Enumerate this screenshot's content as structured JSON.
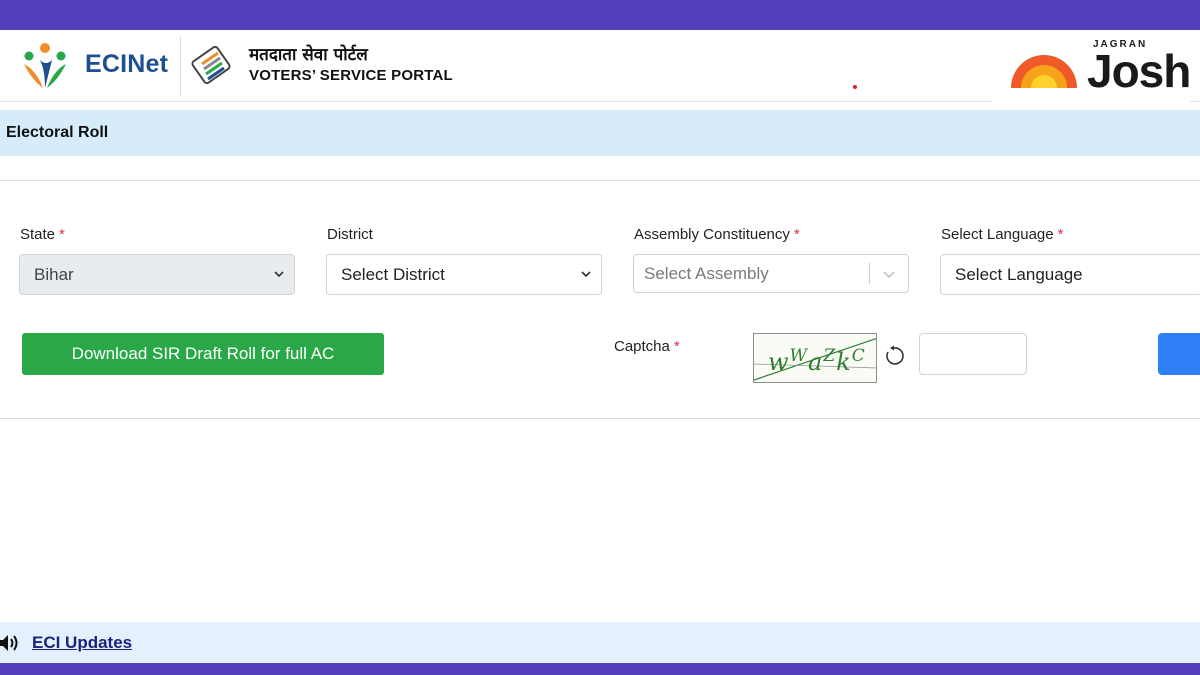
{
  "header": {
    "brand_name": "ECINet",
    "portal_title_hindi": "मतदाता सेवा पोर्टल",
    "portal_title_english": "VOTERS’ SERVICE PORTAL",
    "watermark": {
      "small": "JAGRAN",
      "big": "Josh"
    }
  },
  "section": {
    "title": "Electoral Roll"
  },
  "form": {
    "state": {
      "label": "State",
      "required_mark": "*",
      "value": "Bihar",
      "disabled": true
    },
    "district": {
      "label": "District",
      "placeholder": "Select District"
    },
    "assembly": {
      "label": "Assembly Constituency",
      "required_mark": "*",
      "placeholder": "Select Assembly"
    },
    "language": {
      "label": "Select Language",
      "required_mark": "*",
      "placeholder": "Select Language"
    },
    "download_button": "Download SIR Draft Roll for full AC",
    "captcha": {
      "label": "Captcha",
      "required_mark": "*",
      "text": "wWaZkC"
    }
  },
  "updates": {
    "link": "ECI Updates"
  },
  "colors": {
    "top_bar": "#5240bd",
    "section_bg": "#d6ecfb",
    "download_green": "#2aa847",
    "submit_blue": "#2f7ff6",
    "required_red": "#dc3545",
    "updates_link": "#1a237e"
  },
  "icons": [
    "eci-logo-icon",
    "evm-logo-icon",
    "sun-logo-icon",
    "chevron-down-icon",
    "refresh-icon",
    "speaker-icon"
  ]
}
